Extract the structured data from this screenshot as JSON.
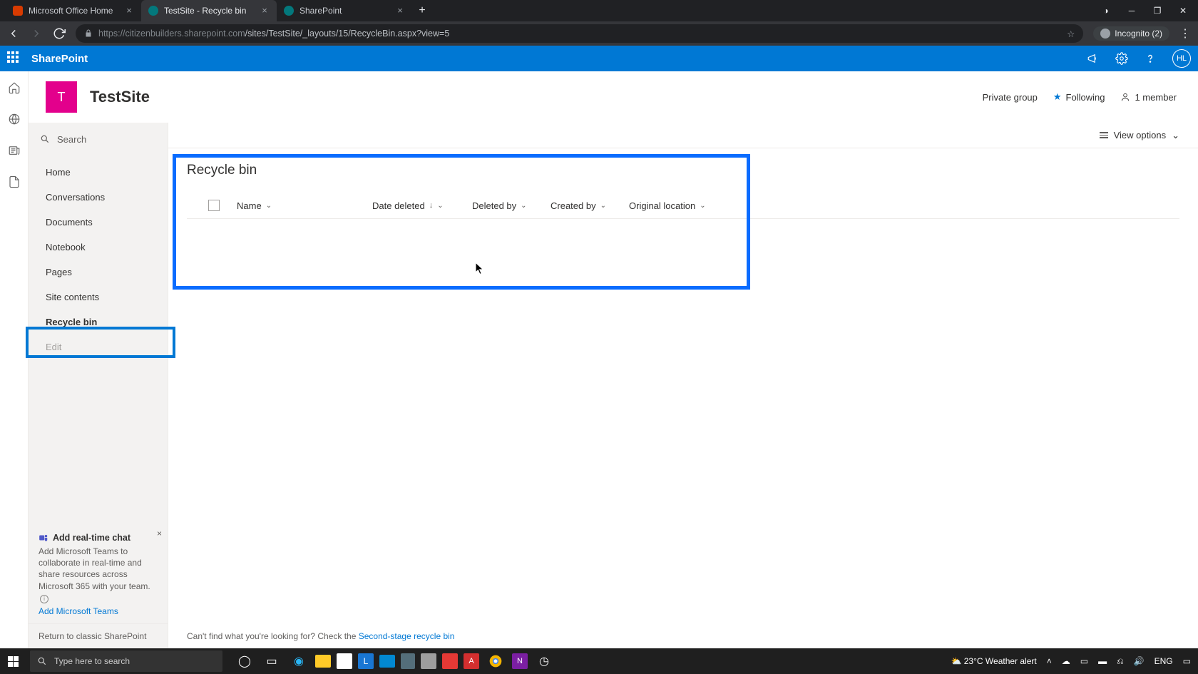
{
  "browser": {
    "tabs": [
      {
        "title": "Microsoft Office Home"
      },
      {
        "title": "TestSite - Recycle bin"
      },
      {
        "title": "SharePoint"
      }
    ],
    "url_host": "https://citizenbuilders.sharepoint.com",
    "url_path": "/sites/TestSite/_layouts/15/RecycleBin.aspx?view=5",
    "incognito_label": "Incognito (2)"
  },
  "suite": {
    "brand": "SharePoint",
    "avatar_initials": "HL"
  },
  "site": {
    "logo_initial": "T",
    "title": "TestSite",
    "privacy": "Private group",
    "following": "Following",
    "members": "1 member"
  },
  "sidebar": {
    "search_placeholder": "Search",
    "items": [
      "Home",
      "Conversations",
      "Documents",
      "Notebook",
      "Pages",
      "Site contents",
      "Recycle bin",
      "Edit"
    ],
    "promo_title": "Add real-time chat",
    "promo_body": "Add Microsoft Teams to collaborate in real-time and share resources across Microsoft 365 with your team.",
    "promo_link": "Add Microsoft Teams",
    "return_classic": "Return to classic SharePoint"
  },
  "main": {
    "view_options": "View options",
    "page_title": "Recycle bin",
    "columns": [
      "Name",
      "Date deleted",
      "Deleted by",
      "Created by",
      "Original location"
    ],
    "footer_pre": "Can't find what you're looking for? Check the ",
    "footer_link": "Second-stage recycle bin"
  },
  "taskbar": {
    "search_placeholder": "Type here to search",
    "weather_temp": "23°C",
    "weather_label": "Weather alert",
    "lang": "ENG"
  }
}
